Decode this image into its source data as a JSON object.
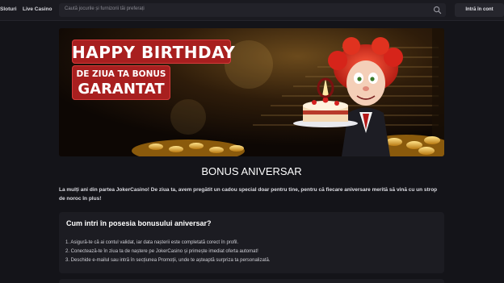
{
  "topbar": {
    "nav": [
      "Sloturi",
      "Live Casino"
    ],
    "search_placeholder": "Caută jocurile și furnizorii tăi preferați",
    "login_label": "Intră în cont"
  },
  "banner": {
    "line1": "HAPPY BIRTHDAY",
    "line2": "DE ZIUA TA BONUS",
    "line3": "GARANTAT"
  },
  "main": {
    "title": "BONUS ANIVERSAR",
    "intro": "La mulți ani din partea JokerCasino! De ziua ta, avem pregătit un cadou special doar pentru tine, pentru că fiecare aniversare merită să vină cu un strop de noroc în plus!",
    "card": {
      "title": "Cum intri în posesia bonusului aniversar?",
      "steps": [
        "1. Asigură-te că ai contul validat, iar data nașterii este completată corect în profil.",
        "2. Conectează-te în ziua ta de naștere pe JokerCasino și primește imediat oferta automat!",
        "3. Deschide e-mailul sau intră în secțiunea Promoții, unde te așteaptă surpriza ta personalizată."
      ]
    }
  },
  "colors": {
    "background": "#141419",
    "banner_red": "#a81f1f",
    "card": "#1c1c22"
  }
}
